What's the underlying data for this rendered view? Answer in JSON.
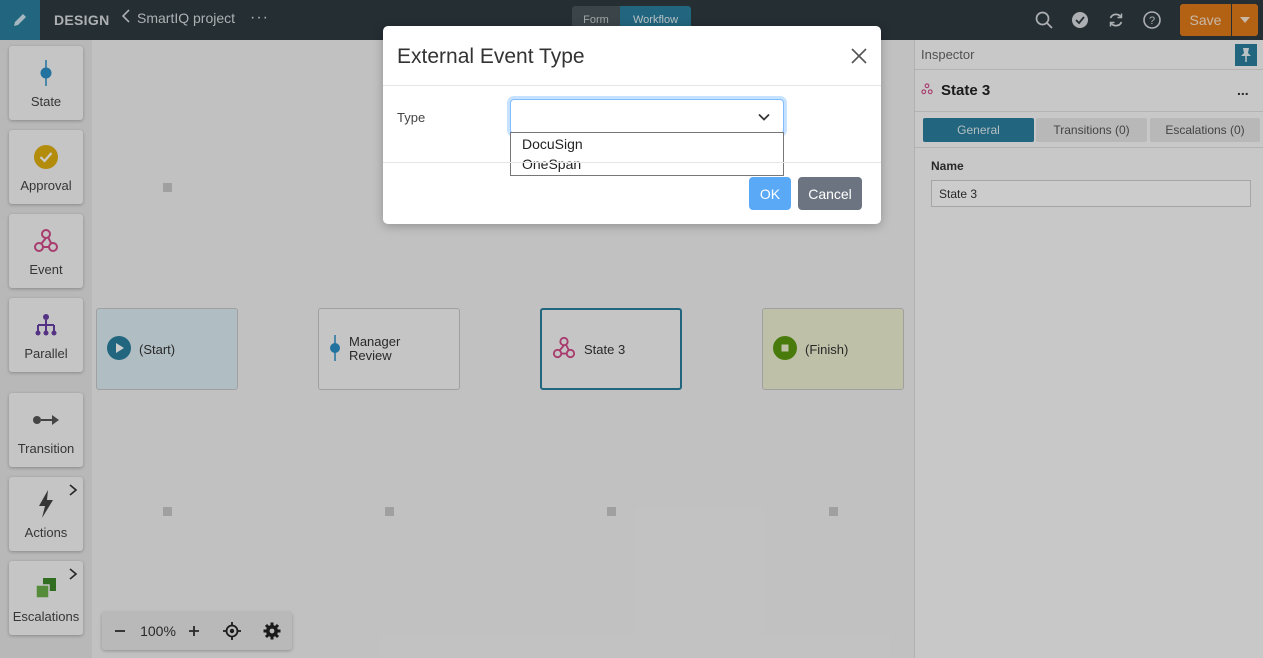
{
  "topbar": {
    "mode": "DESIGN",
    "project": "SmartIQ project",
    "more": "···",
    "tabs": [
      "Form",
      "Workflow"
    ],
    "active_tab": "Workflow",
    "save_label": "Save",
    "icons": [
      "search-icon",
      "check-circle-icon",
      "refresh-icon",
      "help-icon"
    ]
  },
  "toolbox": [
    {
      "label": "State",
      "icon": "state-icon"
    },
    {
      "label": "Approval",
      "icon": "approval-icon"
    },
    {
      "label": "Event",
      "icon": "event-icon"
    },
    {
      "label": "Parallel",
      "icon": "parallel-icon"
    },
    {
      "label": "Transition",
      "icon": "transition-icon"
    },
    {
      "label": "Actions",
      "icon": "lightning-icon"
    },
    {
      "label": "Escalations",
      "icon": "escalation-icon"
    }
  ],
  "canvas": {
    "nodes": [
      {
        "label": "(Start)"
      },
      {
        "label": "Manager Review"
      },
      {
        "label": "State 3"
      },
      {
        "label": "(Finish)"
      }
    ],
    "zoom": "100%"
  },
  "inspector": {
    "title": "Inspector",
    "state_name": "State 3",
    "more": "...",
    "tabs": [
      "General",
      "Transitions (0)",
      "Escalations (0)"
    ],
    "name_label": "Name",
    "name_value": "State 3"
  },
  "modal": {
    "title": "External Event Type",
    "type_label": "Type",
    "selected": "",
    "options": [
      "DocuSign",
      "OneSpan"
    ],
    "ok": "OK",
    "cancel": "Cancel"
  },
  "colors": {
    "accent": "#2b7f9e",
    "save": "#e07b1a",
    "ok": "#5aa9f7",
    "cancel": "#6b7480",
    "event": "#d24b8a"
  }
}
